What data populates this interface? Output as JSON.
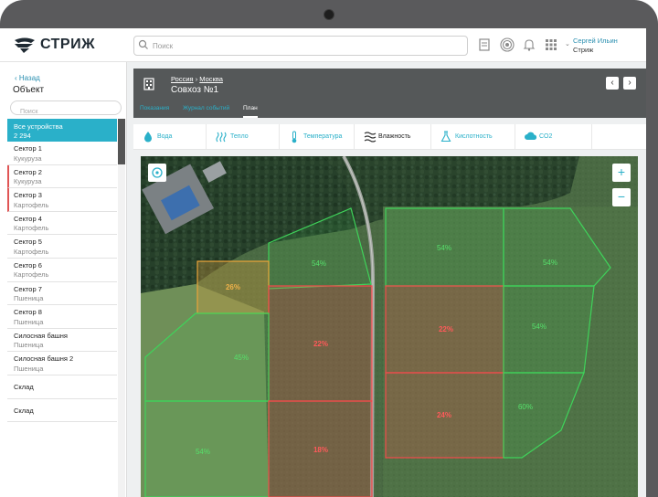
{
  "app": {
    "brand": "СТРИЖ"
  },
  "search": {
    "placeholder": "Поиск"
  },
  "user": {
    "name": "Сергей Ильин",
    "org": "Стриж"
  },
  "sidebar": {
    "back_label": "Назад",
    "title": "Объект",
    "search_placeholder": "Поиск",
    "all": {
      "label": "Все устройства",
      "count": "2 294"
    },
    "items": [
      {
        "name": "Сектор 1",
        "crop": "Кукуруза",
        "alert": false
      },
      {
        "name": "Сектор 2",
        "crop": "Кукуруза",
        "alert": true
      },
      {
        "name": "Сектор 3",
        "crop": "Картофель",
        "alert": true
      },
      {
        "name": "Сектор 4",
        "crop": "Картофель",
        "alert": false
      },
      {
        "name": "Сектор 5",
        "crop": "Картофель",
        "alert": false
      },
      {
        "name": "Сектор 6",
        "crop": "Картофель",
        "alert": false
      },
      {
        "name": "Сектор 7",
        "crop": "Пшеница",
        "alert": false
      },
      {
        "name": "Сектор 8",
        "crop": "Пшеница",
        "alert": false
      },
      {
        "name": "Силосная башня",
        "crop": "Пшеница",
        "alert": false
      },
      {
        "name": "Силосная башня 2",
        "crop": "Пшеница",
        "alert": false
      },
      {
        "name": "Склад",
        "crop": "",
        "alert": false
      },
      {
        "name": "Склад",
        "crop": "",
        "alert": false
      }
    ]
  },
  "header": {
    "breadcrumb": [
      "Россия",
      "Москва"
    ],
    "title": "Совхоз №1",
    "tabs": [
      {
        "label": "Показания",
        "active": false
      },
      {
        "label": "Журнал событий",
        "active": false
      },
      {
        "label": "План",
        "active": true
      }
    ]
  },
  "metrics": [
    {
      "label": "Вода",
      "icon": "drop-icon",
      "active": false
    },
    {
      "label": "Тепло",
      "icon": "heat-icon",
      "active": false
    },
    {
      "label": "Температура",
      "icon": "thermometer-icon",
      "active": false
    },
    {
      "label": "Влажность",
      "icon": "humidity-icon",
      "active": true
    },
    {
      "label": "Кислотность",
      "icon": "flask-icon",
      "active": false
    },
    {
      "label": "CO2",
      "icon": "cloud-icon",
      "active": false
    }
  ],
  "map": {
    "zoom_in": "+",
    "zoom_out": "−",
    "fields": [
      {
        "value": "54%",
        "status": "ok"
      },
      {
        "value": "26%",
        "status": "warning"
      },
      {
        "value": "22%",
        "status": "critical"
      },
      {
        "value": "45%",
        "status": "ok"
      },
      {
        "value": "54%",
        "status": "ok"
      },
      {
        "value": "18%",
        "status": "critical"
      },
      {
        "value": "54%",
        "status": "ok"
      },
      {
        "value": "54%",
        "status": "ok"
      },
      {
        "value": "22%",
        "status": "critical"
      },
      {
        "value": "54%",
        "status": "ok"
      },
      {
        "value": "24%",
        "status": "critical"
      },
      {
        "value": "60%",
        "status": "ok"
      }
    ]
  },
  "colors": {
    "accent": "#2ab0c9",
    "ok": "#3fd35a",
    "warning": "#e8a33a",
    "critical": "#ef4b4b",
    "header": "#555859"
  }
}
